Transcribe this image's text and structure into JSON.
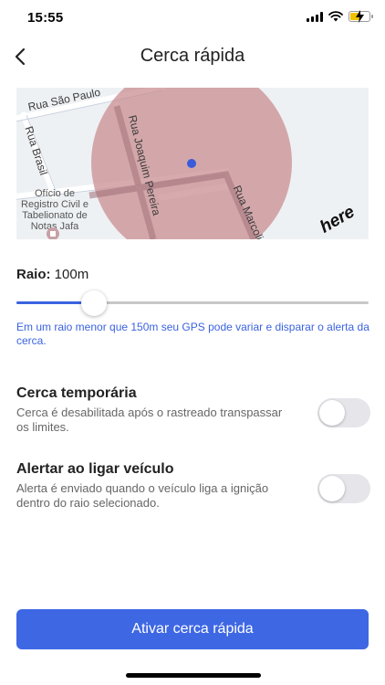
{
  "status_bar": {
    "time": "15:55",
    "battery_level": 0.55
  },
  "header": {
    "title": "Cerca rápida",
    "back_icon": "chevron-left-icon"
  },
  "map": {
    "streets": {
      "rua_sao_paulo": "Rua São Paulo",
      "rua_brasil": "Rua Brasil",
      "rua_joaquim_pereira": "Rua Joaquim Pereira",
      "rua_marcolino": "Rua Marcoli"
    },
    "poi": [
      "Ofício de",
      "Registro Civil e",
      "Tabelionato de",
      "Notas Jafa"
    ],
    "logo": "here",
    "fence_color": "#c98d92",
    "marker_color": "#3b5bdb"
  },
  "radius": {
    "label": "Raio:",
    "value": "100m",
    "slider_fraction": 0.22,
    "hint": "Em um raio menor que 150m seu GPS pode variar e disparar o alerta da cerca."
  },
  "settings": [
    {
      "title": "Cerca temporária",
      "description": "Cerca é desabilitada após o rastreado transpassar os limites.",
      "enabled": false
    },
    {
      "title": "Alertar ao ligar veículo",
      "description": "Alerta é enviado quando o veículo liga a ignição dentro do raio selecionado.",
      "enabled": false
    }
  ],
  "action": {
    "label": "Ativar cerca rápida"
  },
  "colors": {
    "accent": "#3e67e4",
    "hint_text": "#3b63e0"
  }
}
